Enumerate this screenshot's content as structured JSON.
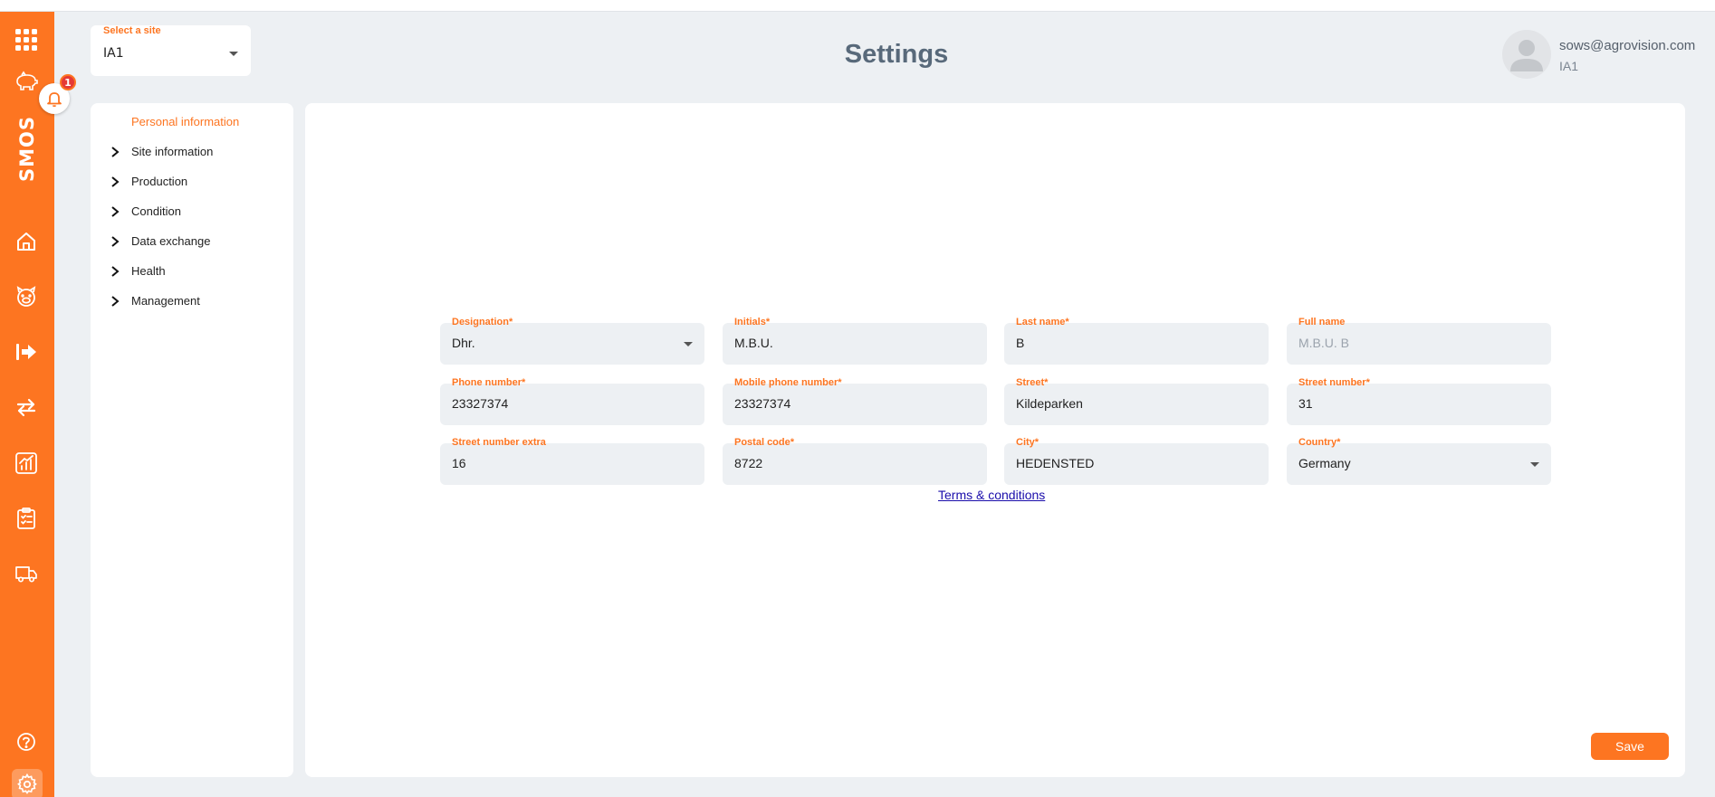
{
  "app": {
    "brand": "SMOS",
    "notification_count": "1",
    "accent_color": "#fd7521"
  },
  "sidebar": {
    "icons": [
      "apps-grid-icon",
      "pig-icon",
      "home-icon",
      "pig-face-icon",
      "exit-arrow-icon",
      "transfer-arrows-icon",
      "chart-icon",
      "clipboard-checklist-icon",
      "truck-icon",
      "help-icon",
      "gear-icon"
    ]
  },
  "header": {
    "site_select_label": "Select a site",
    "site_select_value": "IA1",
    "title": "Settings",
    "user_email": "sows@agrovision.com",
    "user_site": "IA1"
  },
  "nav": {
    "items": [
      {
        "label": "Personal information",
        "active": true
      },
      {
        "label": "Site information"
      },
      {
        "label": "Production"
      },
      {
        "label": "Condition"
      },
      {
        "label": "Data exchange"
      },
      {
        "label": "Health"
      },
      {
        "label": "Management"
      }
    ]
  },
  "form": {
    "fields": [
      {
        "label": "Designation*",
        "value": "Dhr.",
        "type": "select"
      },
      {
        "label": "Initials*",
        "value": "M.B.U."
      },
      {
        "label": "Last name*",
        "value": "B"
      },
      {
        "label": "Full name",
        "value": "M.B.U. B",
        "disabled": true
      },
      {
        "label": "Phone number*",
        "value": "23327374"
      },
      {
        "label": "Mobile phone number*",
        "value": "23327374"
      },
      {
        "label": "Street*",
        "value": "Kildeparken"
      },
      {
        "label": "Street number*",
        "value": "31"
      },
      {
        "label": "Street number extra",
        "value": "16"
      },
      {
        "label": "Postal code*",
        "value": "8722"
      },
      {
        "label": "City*",
        "value": "HEDENSTED"
      },
      {
        "label": "Country*",
        "value": "Germany",
        "type": "select"
      }
    ],
    "terms_link": "Terms & conditions",
    "save_label": "Save"
  }
}
